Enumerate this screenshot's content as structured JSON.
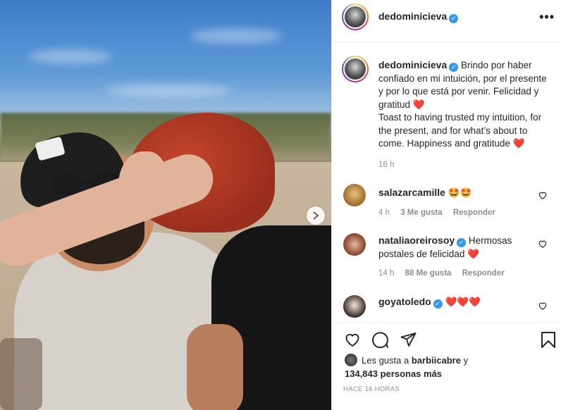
{
  "post": {
    "username": "dedominicieva",
    "verified_icon": "verified-badge-icon",
    "more_icon": "more-options-icon"
  },
  "caption": {
    "username": "dedominicieva",
    "text_es": "Brindo por haber confiado en mi intuición, por el presente y por lo que está por venir. Felicidad y gratitud",
    "text_en": "Toast to having trusted my intuition, for the present, and for what’s about to come. Happiness and gratitude",
    "emoji": "❤️",
    "time": "16 h"
  },
  "comments": [
    {
      "username": "salazarcamille",
      "verified": false,
      "text": "🤩🤩",
      "time": "4 h",
      "likes": "3 Me gusta",
      "reply": "Responder"
    },
    {
      "username": "nataliaoreirosoy",
      "verified": true,
      "text": "Hermosas postales de felicidad ❤️",
      "time": "14 h",
      "likes": "88 Me gusta",
      "reply": "Responder"
    },
    {
      "username": "goyatoledo",
      "verified": true,
      "text": "❤️❤️❤️",
      "time": "",
      "likes": "",
      "reply": ""
    }
  ],
  "liked_by": {
    "prefix": "Les gusta a",
    "user": "barbiicabre",
    "connector": "y",
    "count": "134,843 personas más"
  },
  "timestamp": "HACE 16 HORAS",
  "colors": {
    "verified": "#3897f0",
    "text": "#262626",
    "muted": "#8e8e8e",
    "heart": "#ed4956"
  }
}
